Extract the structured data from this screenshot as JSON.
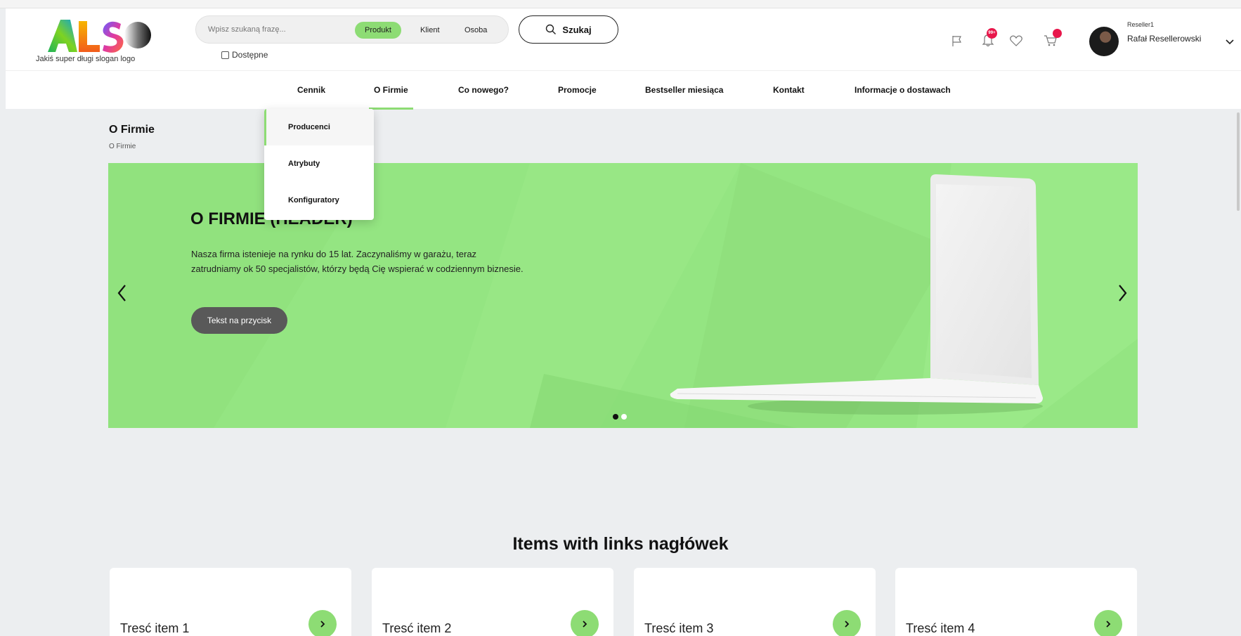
{
  "header": {
    "logo_text": "ALSO",
    "slogan": "Jakiś super długi slogan logo",
    "search": {
      "placeholder": "Wpisz szukaną frazę...",
      "scopes": [
        "Produkt",
        "Klient",
        "Osoba"
      ],
      "active_scope": "Produkt",
      "button_label": "Szukaj",
      "available_label": "Dostępne"
    },
    "notifications_badge": "99+",
    "user": {
      "role": "Reseller1",
      "name": "Rafał Resellerowski"
    }
  },
  "nav": {
    "items": [
      {
        "label": "Cennik"
      },
      {
        "label": "O Firmie"
      },
      {
        "label": "Co nowego?"
      },
      {
        "label": "Promocje"
      },
      {
        "label": "Bestseller miesiąca"
      },
      {
        "label": "Kontakt"
      },
      {
        "label": "Informacje o dostawach"
      }
    ],
    "active_item": "O Firmie",
    "dropdown": [
      "Producenci",
      "Atrybuty",
      "Konfiguratory"
    ]
  },
  "page": {
    "title": "O Firmie",
    "breadcrumb": "O Firmie"
  },
  "hero": {
    "title": "O FIRMIE (HEADER)",
    "text": "Nasza firma istenieje na rynku do 15 lat. Zaczynaliśmy w garażu, teraz zatrudniamy ok 50 specjalistów, którzy będą Cię wspierać w codziennym biznesie.",
    "button_label": "Tekst na przycisk",
    "slide_count": 2,
    "active_slide": 1
  },
  "items_section": {
    "title": "Items with links nagłówek",
    "items": [
      {
        "label": "Tresć item 1"
      },
      {
        "label": "Tresć item 2"
      },
      {
        "label": "Tresć item 3"
      },
      {
        "label": "Tresć item 4"
      }
    ]
  },
  "colors": {
    "accent_green": "#8ddc74",
    "hero_green": "#94e582",
    "badge_red": "#e8174b",
    "page_bg": "#eceef0",
    "hero_button": "#595959"
  }
}
